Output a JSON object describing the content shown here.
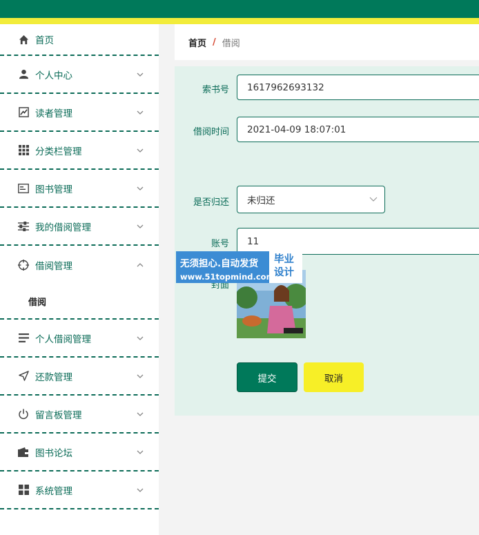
{
  "colors": {
    "primary": "#00795a",
    "accent": "#f2ec3b",
    "panel": "#e2f2ec"
  },
  "sidebar": {
    "items": [
      {
        "label": "首页",
        "icon": "home-icon"
      },
      {
        "label": "个人中心",
        "icon": "user-icon"
      },
      {
        "label": "读者管理",
        "icon": "chart-icon"
      },
      {
        "label": "分类栏管理",
        "icon": "grid-icon"
      },
      {
        "label": "图书管理",
        "icon": "card-icon"
      },
      {
        "label": "我的借阅管理",
        "icon": "sliders-icon"
      },
      {
        "label": "借阅管理",
        "icon": "crosshair-icon",
        "expanded": true
      },
      {
        "label": "个人借阅管理",
        "icon": "list-icon"
      },
      {
        "label": "还款管理",
        "icon": "send-icon"
      },
      {
        "label": "留言板管理",
        "icon": "power-icon"
      },
      {
        "label": "图书论坛",
        "icon": "wallet-icon"
      },
      {
        "label": "系统管理",
        "icon": "apps-icon"
      }
    ],
    "sub_item": "借阅"
  },
  "breadcrumb": {
    "home": "首页",
    "separator": "/",
    "current": "借阅"
  },
  "form": {
    "index_label": "索书号",
    "index_value": "1617962693132",
    "time_label": "借阅时间",
    "time_value": "2021-04-09 18:07:01",
    "returned_label": "是否归还",
    "returned_value": "未归还",
    "account_label": "账号",
    "account_value": "11",
    "cover_label": "封面"
  },
  "buttons": {
    "submit": "提交",
    "cancel": "取消"
  },
  "watermark": {
    "line1": "无须担心.自动发货",
    "line2": "www.51topmind.com",
    "badge1": "毕业",
    "badge2": "设计"
  }
}
